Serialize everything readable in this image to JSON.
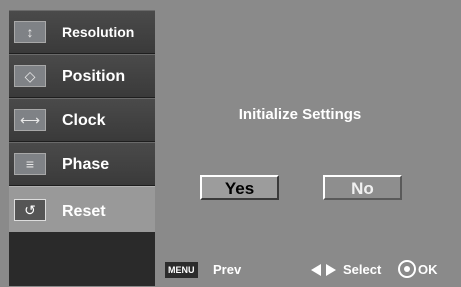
{
  "sidebar": {
    "items": [
      {
        "label": "Resolution",
        "icon": "resolution-icon",
        "glyph": "↕"
      },
      {
        "label": "Position",
        "icon": "position-icon",
        "glyph": "◇"
      },
      {
        "label": "Clock",
        "icon": "clock-icon",
        "glyph": "⟷"
      },
      {
        "label": "Phase",
        "icon": "phase-icon",
        "glyph": "≡"
      },
      {
        "label": "Reset",
        "icon": "reset-icon",
        "glyph": "↺"
      }
    ],
    "active_index": 4
  },
  "dialog": {
    "title": "Initialize Settings",
    "yes_label": "Yes",
    "no_label": "No"
  },
  "footer": {
    "menu_key": "MENU",
    "prev_label": "Prev",
    "select_label": "Select",
    "ok_label": "OK"
  }
}
